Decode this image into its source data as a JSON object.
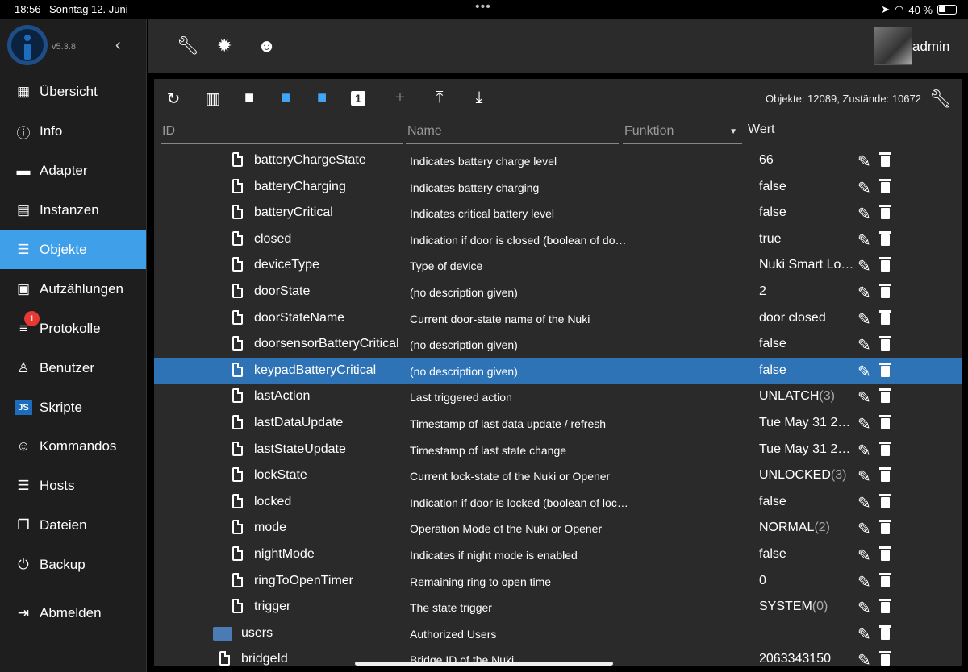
{
  "status_bar": {
    "time": "18:56",
    "date": "Sonntag 12. Juni",
    "dots": "•••",
    "battery_text": "40 %",
    "location_icon": "location-arrow-icon",
    "wifi_icon": "wifi-icon"
  },
  "sidebar": {
    "version": "v5.3.8",
    "collapse_glyph": "‹",
    "items": [
      {
        "label": "Übersicht",
        "icon": "grid-icon",
        "glyph": "▦"
      },
      {
        "label": "Info",
        "icon": "info-icon",
        "glyph": "ⓘ"
      },
      {
        "label": "Adapter",
        "icon": "store-icon",
        "glyph": "▬"
      },
      {
        "label": "Instanzen",
        "icon": "instances-icon",
        "glyph": "▤"
      },
      {
        "label": "Objekte",
        "icon": "list-icon",
        "glyph": "☰",
        "active": true
      },
      {
        "label": "Aufzählungen",
        "icon": "enum-icon",
        "glyph": "▣"
      },
      {
        "label": "Protokolle",
        "icon": "log-icon",
        "glyph": "≡",
        "badge": "1"
      },
      {
        "label": "Benutzer",
        "icon": "user-icon",
        "glyph": "♙"
      },
      {
        "label": "Skripte",
        "icon": "js-icon",
        "glyph": "JS"
      },
      {
        "label": "Kommandos",
        "icon": "person-icon",
        "glyph": "☺"
      },
      {
        "label": "Hosts",
        "icon": "hosts-icon",
        "glyph": "☰"
      },
      {
        "label": "Dateien",
        "icon": "files-icon",
        "glyph": "❐"
      },
      {
        "label": "Backup",
        "icon": "backup-icon",
        "glyph": "⏻"
      },
      {
        "label": "Abmelden",
        "icon": "logout-icon",
        "glyph": "⇥"
      }
    ]
  },
  "appbar": {
    "user": "admin",
    "icons": [
      "wrench-icon",
      "brightness-icon",
      "head-icon"
    ]
  },
  "toolbar": {
    "counts": "Objekte: 12089, Zustände: 10672",
    "tools": [
      {
        "name": "refresh-icon",
        "glyph": "↻"
      },
      {
        "name": "columns-icon",
        "glyph": "▥"
      },
      {
        "name": "folder-icon",
        "glyph": "■"
      },
      {
        "name": "folder-open-icon",
        "glyph": "■",
        "blue": true
      },
      {
        "name": "folder-closed-icon",
        "glyph": "■",
        "blue": true
      },
      {
        "name": "one-box-icon",
        "glyph": "1"
      },
      {
        "name": "add-icon",
        "glyph": "+",
        "dim": true
      },
      {
        "name": "upload-icon",
        "glyph": "⤒"
      },
      {
        "name": "download-icon",
        "glyph": "⤓"
      }
    ]
  },
  "filters": {
    "id": "ID",
    "name": "Name",
    "funktion": "Funktion",
    "wert": "Wert"
  },
  "rows": [
    {
      "id": "batteryChargeState",
      "name": "Indicates battery charge level",
      "value": "66",
      "suffix": "",
      "type": "file",
      "indent": 1
    },
    {
      "id": "batteryCharging",
      "name": "Indicates battery charging",
      "value": "false",
      "suffix": "",
      "type": "file",
      "indent": 1
    },
    {
      "id": "batteryCritical",
      "name": "Indicates critical battery level",
      "value": "false",
      "suffix": "",
      "type": "file",
      "indent": 1
    },
    {
      "id": "closed",
      "name": "Indication if door is closed (boolean of do…",
      "value": "true",
      "suffix": "",
      "type": "file",
      "indent": 1
    },
    {
      "id": "deviceType",
      "name": "Type of device",
      "value": "Nuki Smart Lo…",
      "suffix": "",
      "type": "file",
      "indent": 1
    },
    {
      "id": "doorState",
      "name": "(no description given)",
      "value": "2",
      "suffix": "",
      "type": "file",
      "indent": 1
    },
    {
      "id": "doorStateName",
      "name": "Current door-state name of the Nuki",
      "value": "door closed",
      "suffix": "",
      "type": "file",
      "indent": 1
    },
    {
      "id": "doorsensorBatteryCritical",
      "name": "(no description given)",
      "value": "false",
      "suffix": "",
      "type": "file",
      "indent": 1
    },
    {
      "id": "keypadBatteryCritical",
      "name": "(no description given)",
      "value": "false",
      "suffix": "",
      "type": "file",
      "indent": 1,
      "selected": true
    },
    {
      "id": "lastAction",
      "name": "Last triggered action",
      "value": "UNLATCH",
      "suffix": "(3)",
      "type": "file",
      "indent": 1
    },
    {
      "id": "lastDataUpdate",
      "name": "Timestamp of last data update / refresh",
      "value": "Tue May 31 2…",
      "suffix": "",
      "type": "file",
      "indent": 1
    },
    {
      "id": "lastStateUpdate",
      "name": "Timestamp of last state change",
      "value": "Tue May 31 2…",
      "suffix": "",
      "type": "file",
      "indent": 1
    },
    {
      "id": "lockState",
      "name": "Current lock-state of the Nuki or Opener",
      "value": "UNLOCKED",
      "suffix": "(3)",
      "type": "file",
      "indent": 1
    },
    {
      "id": "locked",
      "name": "Indication if door is locked (boolean of loc…",
      "value": "false",
      "suffix": "",
      "type": "file",
      "indent": 1
    },
    {
      "id": "mode",
      "name": "Operation Mode of the Nuki or Opener",
      "value": "NORMAL",
      "suffix": "(2)",
      "type": "file",
      "indent": 1
    },
    {
      "id": "nightMode",
      "name": "Indicates if night mode is enabled",
      "value": "false",
      "suffix": "",
      "type": "file",
      "indent": 1
    },
    {
      "id": "ringToOpenTimer",
      "name": "Remaining ring to open time",
      "value": "0",
      "suffix": "",
      "type": "file",
      "indent": 1
    },
    {
      "id": "trigger",
      "name": "The state trigger",
      "value": "SYSTEM",
      "suffix": "(0)",
      "type": "file",
      "indent": 1
    },
    {
      "id": "users",
      "name": "Authorized Users",
      "value": "",
      "suffix": "",
      "type": "folder",
      "indent": 0
    },
    {
      "id": "bridgeId",
      "name": "Bridge ID of the Nuki",
      "value": "2063343150",
      "suffix": "",
      "type": "file",
      "indent": 0
    }
  ]
}
